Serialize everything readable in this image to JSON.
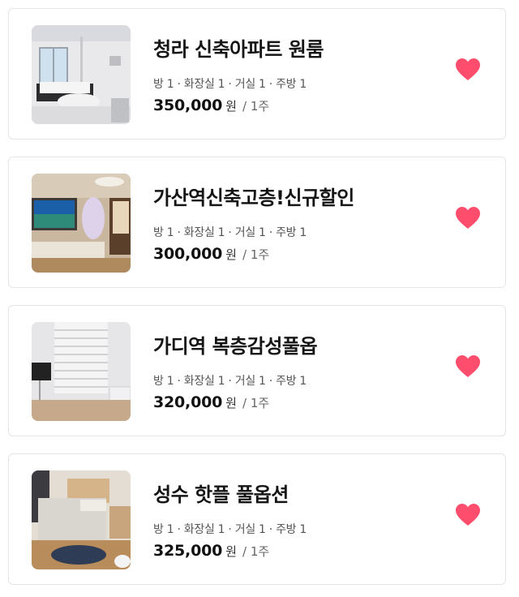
{
  "colors": {
    "heart": "#ff4d6d",
    "border": "#e4e4e4"
  },
  "listings": [
    {
      "image": "room-photo",
      "title": "청라 신축아파트 원룸",
      "meta": "방 1 · 화장실 1 · 거실 1 · 주방 1",
      "price": "350,000",
      "unit": "원",
      "period": "/ 1주",
      "favorite_icon": "heart-icon"
    },
    {
      "image": "room-photo",
      "title": "가산역신축고층!신규할인",
      "meta": "방 1 · 화장실 1 · 거실 1 · 주방 1",
      "price": "300,000",
      "unit": "원",
      "period": "/ 1주",
      "favorite_icon": "heart-icon"
    },
    {
      "image": "room-photo",
      "title": "가디역 복층감성풀옵",
      "meta": "방 1 · 화장실 1 · 거실 1 · 주방 1",
      "price": "320,000",
      "unit": "원",
      "period": "/ 1주",
      "favorite_icon": "heart-icon"
    },
    {
      "image": "room-photo",
      "title": "성수 핫플 풀옵션",
      "meta": "방 1 · 화장실 1 · 거실 1 · 주방 1",
      "price": "325,000",
      "unit": "원",
      "period": "/ 1주",
      "favorite_icon": "heart-icon"
    }
  ]
}
